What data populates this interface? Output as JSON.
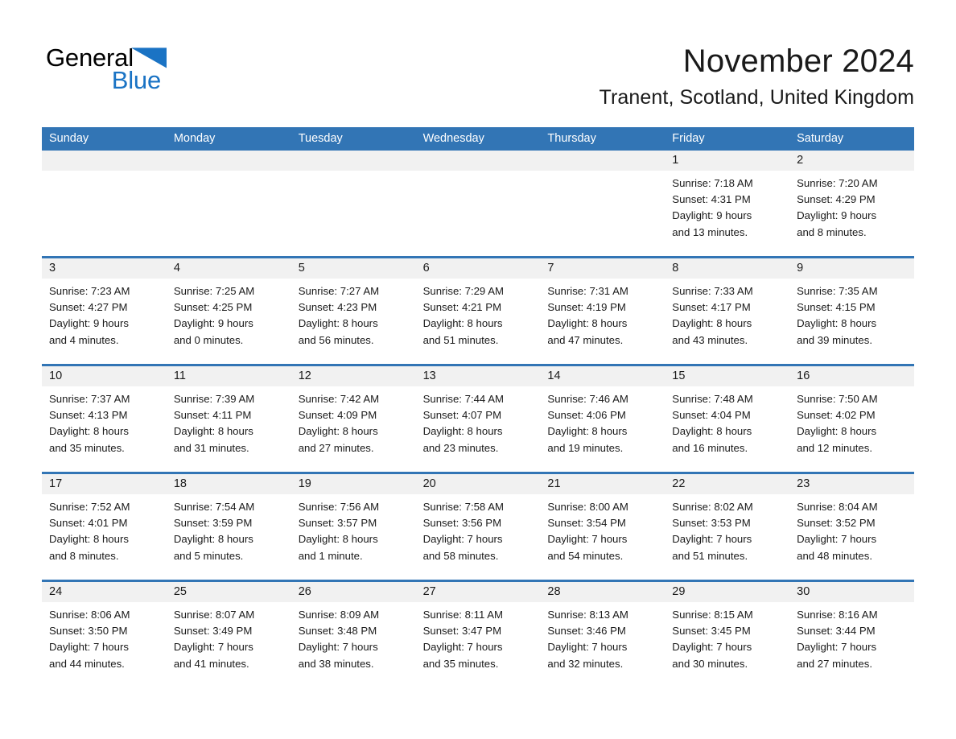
{
  "brand": {
    "name_part1": "General",
    "name_part2": "Blue",
    "triangle_color": "#1a73c4",
    "text_color": "#000000",
    "accent_color": "#1a73c4"
  },
  "header": {
    "month_title": "November 2024",
    "location": "Tranent, Scotland, United Kingdom"
  },
  "theme": {
    "header_blue": "#3275b5",
    "daynum_band": "#f1f1f1",
    "separator_blue": "#3275b5",
    "text": "#1a1a1a"
  },
  "weekdays": [
    "Sunday",
    "Monday",
    "Tuesday",
    "Wednesday",
    "Thursday",
    "Friday",
    "Saturday"
  ],
  "labels": {
    "sunrise_prefix": "Sunrise:",
    "sunset_prefix": "Sunset:",
    "daylight_prefix": "Daylight:"
  },
  "weeks": [
    [
      {
        "day": "",
        "empty": true
      },
      {
        "day": "",
        "empty": true
      },
      {
        "day": "",
        "empty": true
      },
      {
        "day": "",
        "empty": true
      },
      {
        "day": "",
        "empty": true
      },
      {
        "day": "1",
        "sunrise": "Sunrise: 7:18 AM",
        "sunset": "Sunset: 4:31 PM",
        "daylight_l1": "Daylight: 9 hours",
        "daylight_l2": "and 13 minutes."
      },
      {
        "day": "2",
        "sunrise": "Sunrise: 7:20 AM",
        "sunset": "Sunset: 4:29 PM",
        "daylight_l1": "Daylight: 9 hours",
        "daylight_l2": "and 8 minutes."
      }
    ],
    [
      {
        "day": "3",
        "sunrise": "Sunrise: 7:23 AM",
        "sunset": "Sunset: 4:27 PM",
        "daylight_l1": "Daylight: 9 hours",
        "daylight_l2": "and 4 minutes."
      },
      {
        "day": "4",
        "sunrise": "Sunrise: 7:25 AM",
        "sunset": "Sunset: 4:25 PM",
        "daylight_l1": "Daylight: 9 hours",
        "daylight_l2": "and 0 minutes."
      },
      {
        "day": "5",
        "sunrise": "Sunrise: 7:27 AM",
        "sunset": "Sunset: 4:23 PM",
        "daylight_l1": "Daylight: 8 hours",
        "daylight_l2": "and 56 minutes."
      },
      {
        "day": "6",
        "sunrise": "Sunrise: 7:29 AM",
        "sunset": "Sunset: 4:21 PM",
        "daylight_l1": "Daylight: 8 hours",
        "daylight_l2": "and 51 minutes."
      },
      {
        "day": "7",
        "sunrise": "Sunrise: 7:31 AM",
        "sunset": "Sunset: 4:19 PM",
        "daylight_l1": "Daylight: 8 hours",
        "daylight_l2": "and 47 minutes."
      },
      {
        "day": "8",
        "sunrise": "Sunrise: 7:33 AM",
        "sunset": "Sunset: 4:17 PM",
        "daylight_l1": "Daylight: 8 hours",
        "daylight_l2": "and 43 minutes."
      },
      {
        "day": "9",
        "sunrise": "Sunrise: 7:35 AM",
        "sunset": "Sunset: 4:15 PM",
        "daylight_l1": "Daylight: 8 hours",
        "daylight_l2": "and 39 minutes."
      }
    ],
    [
      {
        "day": "10",
        "sunrise": "Sunrise: 7:37 AM",
        "sunset": "Sunset: 4:13 PM",
        "daylight_l1": "Daylight: 8 hours",
        "daylight_l2": "and 35 minutes."
      },
      {
        "day": "11",
        "sunrise": "Sunrise: 7:39 AM",
        "sunset": "Sunset: 4:11 PM",
        "daylight_l1": "Daylight: 8 hours",
        "daylight_l2": "and 31 minutes."
      },
      {
        "day": "12",
        "sunrise": "Sunrise: 7:42 AM",
        "sunset": "Sunset: 4:09 PM",
        "daylight_l1": "Daylight: 8 hours",
        "daylight_l2": "and 27 minutes."
      },
      {
        "day": "13",
        "sunrise": "Sunrise: 7:44 AM",
        "sunset": "Sunset: 4:07 PM",
        "daylight_l1": "Daylight: 8 hours",
        "daylight_l2": "and 23 minutes."
      },
      {
        "day": "14",
        "sunrise": "Sunrise: 7:46 AM",
        "sunset": "Sunset: 4:06 PM",
        "daylight_l1": "Daylight: 8 hours",
        "daylight_l2": "and 19 minutes."
      },
      {
        "day": "15",
        "sunrise": "Sunrise: 7:48 AM",
        "sunset": "Sunset: 4:04 PM",
        "daylight_l1": "Daylight: 8 hours",
        "daylight_l2": "and 16 minutes."
      },
      {
        "day": "16",
        "sunrise": "Sunrise: 7:50 AM",
        "sunset": "Sunset: 4:02 PM",
        "daylight_l1": "Daylight: 8 hours",
        "daylight_l2": "and 12 minutes."
      }
    ],
    [
      {
        "day": "17",
        "sunrise": "Sunrise: 7:52 AM",
        "sunset": "Sunset: 4:01 PM",
        "daylight_l1": "Daylight: 8 hours",
        "daylight_l2": "and 8 minutes."
      },
      {
        "day": "18",
        "sunrise": "Sunrise: 7:54 AM",
        "sunset": "Sunset: 3:59 PM",
        "daylight_l1": "Daylight: 8 hours",
        "daylight_l2": "and 5 minutes."
      },
      {
        "day": "19",
        "sunrise": "Sunrise: 7:56 AM",
        "sunset": "Sunset: 3:57 PM",
        "daylight_l1": "Daylight: 8 hours",
        "daylight_l2": "and 1 minute."
      },
      {
        "day": "20",
        "sunrise": "Sunrise: 7:58 AM",
        "sunset": "Sunset: 3:56 PM",
        "daylight_l1": "Daylight: 7 hours",
        "daylight_l2": "and 58 minutes."
      },
      {
        "day": "21",
        "sunrise": "Sunrise: 8:00 AM",
        "sunset": "Sunset: 3:54 PM",
        "daylight_l1": "Daylight: 7 hours",
        "daylight_l2": "and 54 minutes."
      },
      {
        "day": "22",
        "sunrise": "Sunrise: 8:02 AM",
        "sunset": "Sunset: 3:53 PM",
        "daylight_l1": "Daylight: 7 hours",
        "daylight_l2": "and 51 minutes."
      },
      {
        "day": "23",
        "sunrise": "Sunrise: 8:04 AM",
        "sunset": "Sunset: 3:52 PM",
        "daylight_l1": "Daylight: 7 hours",
        "daylight_l2": "and 48 minutes."
      }
    ],
    [
      {
        "day": "24",
        "sunrise": "Sunrise: 8:06 AM",
        "sunset": "Sunset: 3:50 PM",
        "daylight_l1": "Daylight: 7 hours",
        "daylight_l2": "and 44 minutes."
      },
      {
        "day": "25",
        "sunrise": "Sunrise: 8:07 AM",
        "sunset": "Sunset: 3:49 PM",
        "daylight_l1": "Daylight: 7 hours",
        "daylight_l2": "and 41 minutes."
      },
      {
        "day": "26",
        "sunrise": "Sunrise: 8:09 AM",
        "sunset": "Sunset: 3:48 PM",
        "daylight_l1": "Daylight: 7 hours",
        "daylight_l2": "and 38 minutes."
      },
      {
        "day": "27",
        "sunrise": "Sunrise: 8:11 AM",
        "sunset": "Sunset: 3:47 PM",
        "daylight_l1": "Daylight: 7 hours",
        "daylight_l2": "and 35 minutes."
      },
      {
        "day": "28",
        "sunrise": "Sunrise: 8:13 AM",
        "sunset": "Sunset: 3:46 PM",
        "daylight_l1": "Daylight: 7 hours",
        "daylight_l2": "and 32 minutes."
      },
      {
        "day": "29",
        "sunrise": "Sunrise: 8:15 AM",
        "sunset": "Sunset: 3:45 PM",
        "daylight_l1": "Daylight: 7 hours",
        "daylight_l2": "and 30 minutes."
      },
      {
        "day": "30",
        "sunrise": "Sunrise: 8:16 AM",
        "sunset": "Sunset: 3:44 PM",
        "daylight_l1": "Daylight: 7 hours",
        "daylight_l2": "and 27 minutes."
      }
    ]
  ]
}
